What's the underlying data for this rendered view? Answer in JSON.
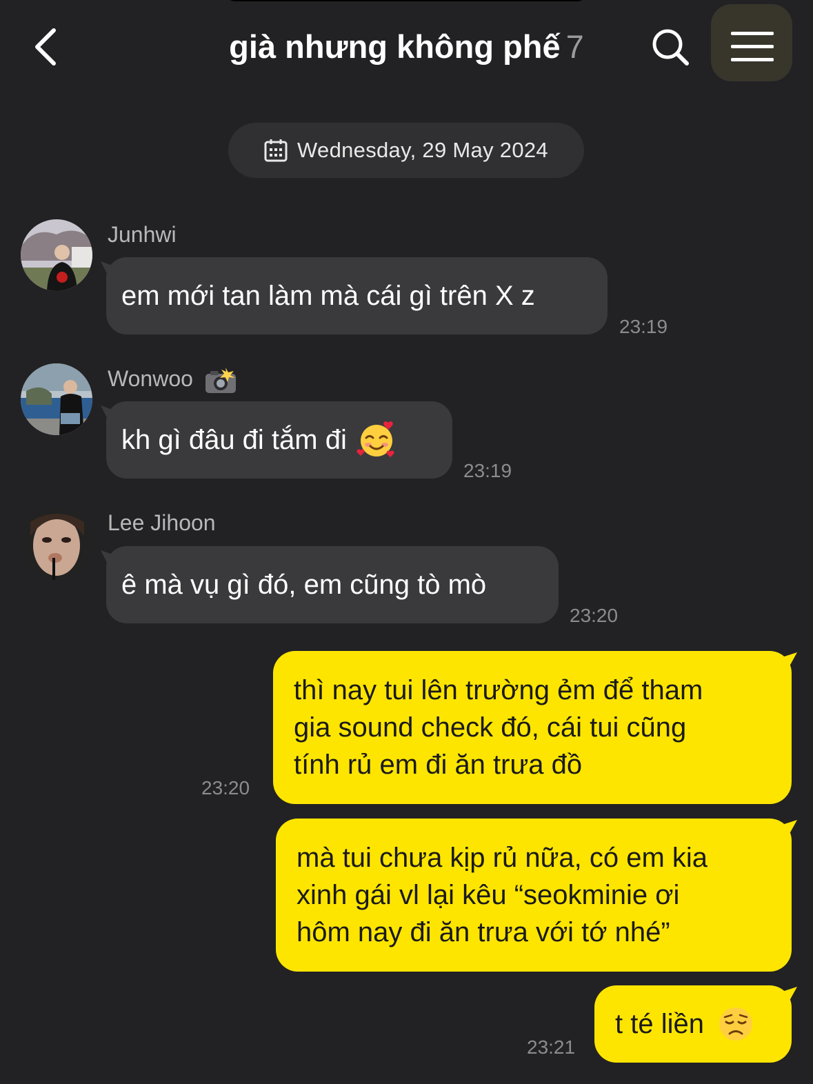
{
  "header": {
    "title": "già nhưng không phế",
    "member_count": "7"
  },
  "date_divider": {
    "text": "Wednesday, 29 May 2024"
  },
  "messages": [
    {
      "sender": "Junhwi",
      "text": "em mới tan làm mà cái gì trên X z",
      "time": "23:19"
    },
    {
      "sender": "Wonwoo",
      "text": "kh gì đâu đi tắm đi",
      "emoji": "smiling-face-with-hearts-icon",
      "time": "23:19"
    },
    {
      "sender": "Lee Jihoon",
      "text": "ê mà vụ gì đó, em cũng tò mò",
      "time": "23:20"
    }
  ],
  "outgoing": [
    {
      "lines": [
        "thì nay tui lên trường ẻm để tham",
        "gia sound check đó, cái tui cũng",
        "tính rủ em đi ăn trưa đồ"
      ],
      "time": "23:20"
    },
    {
      "lines": [
        "mà tui chưa kịp rủ nữa, có em kia",
        "xinh gái vl lại kêu “seokminie ơi",
        "hôm nay đi ăn trưa với tớ nhé”"
      ]
    },
    {
      "text": "t té liền",
      "emoji": "disappointed-face-icon",
      "time": "23:21"
    }
  ],
  "colors": {
    "background": "#222224",
    "incoming_bubble": "#3a3a3c",
    "outgoing_bubble": "#fee500",
    "timestamp": "#8c8c8c"
  }
}
